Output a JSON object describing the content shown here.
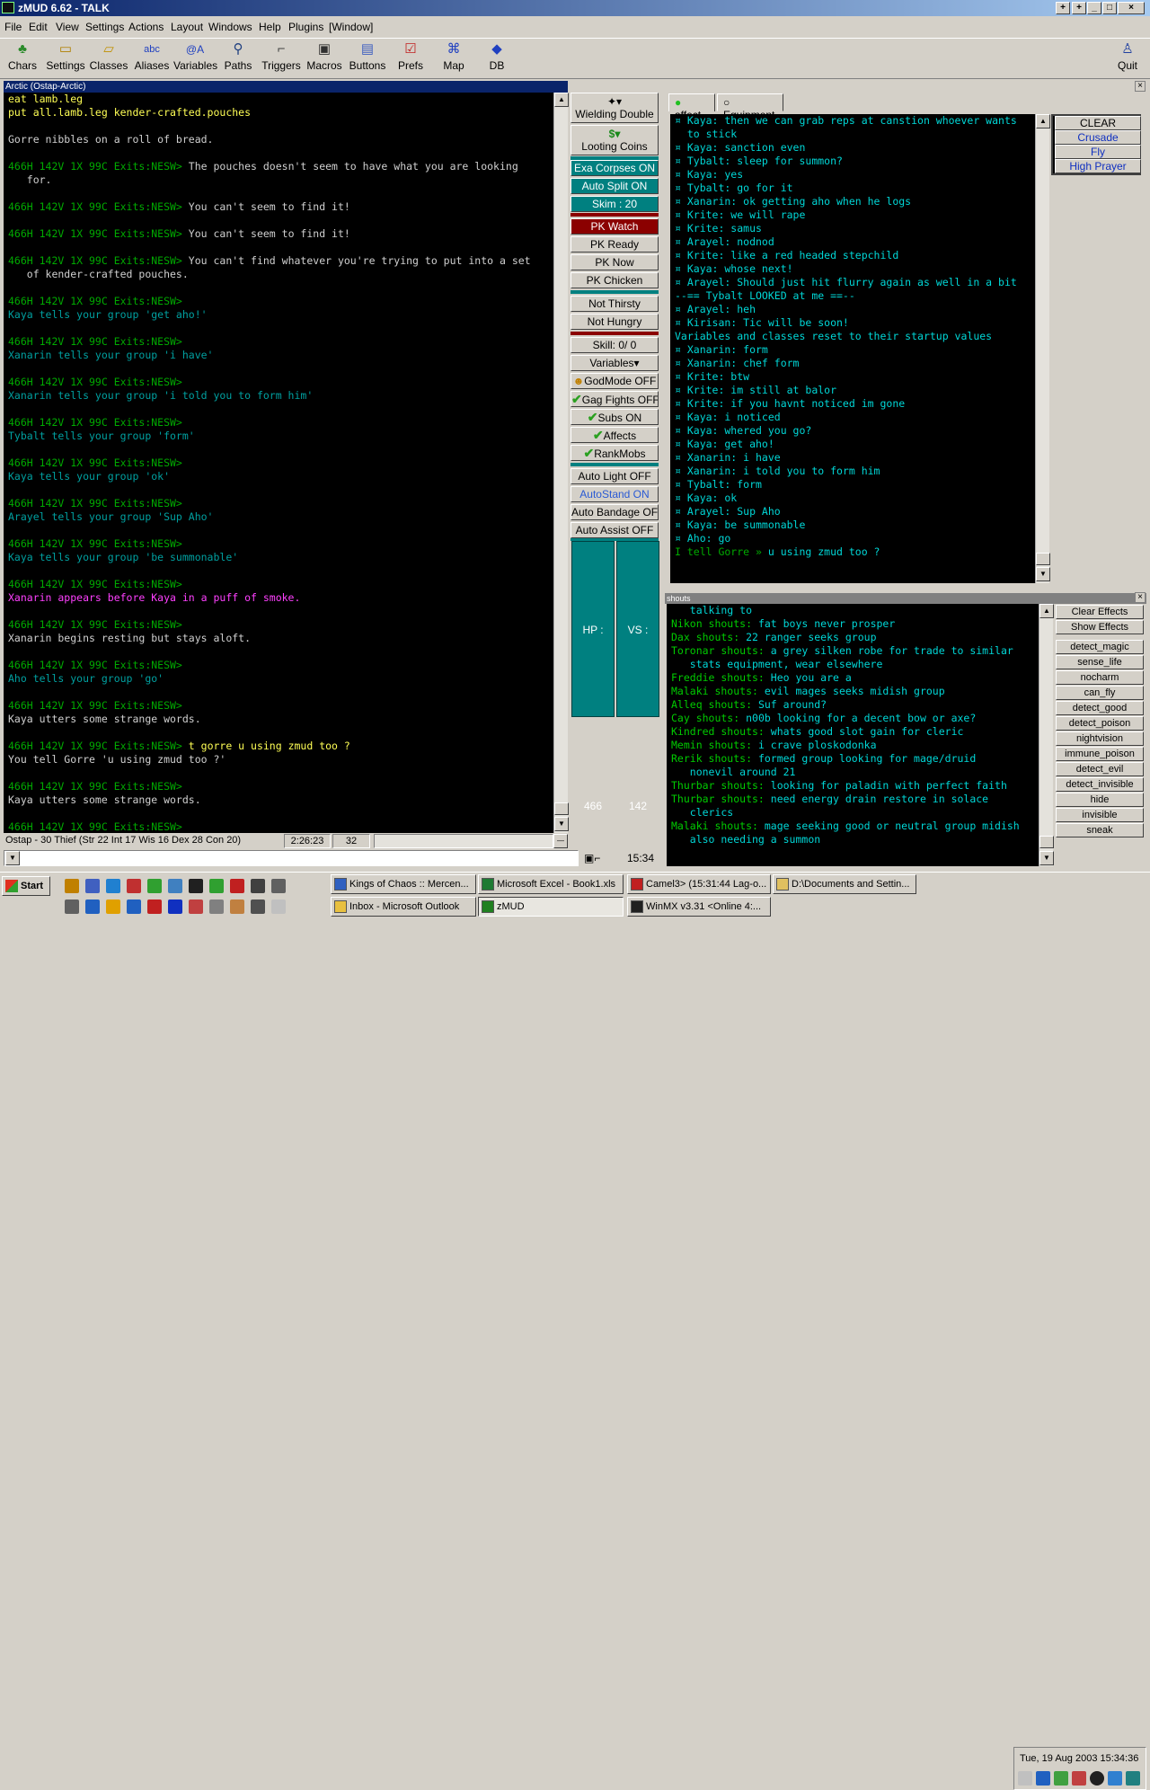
{
  "window": {
    "title": "zMUD 6.62 - TALK"
  },
  "menu": [
    "File",
    "Edit",
    "View",
    "Settings",
    "Actions",
    "Layout",
    "Windows",
    "Help",
    "Plugins",
    "[Window]"
  ],
  "toolbar": [
    {
      "label": "Chars",
      "icon": "chars-icon"
    },
    {
      "label": "Settings",
      "icon": "settings-icon"
    },
    {
      "label": "Classes",
      "icon": "classes-icon"
    },
    {
      "label": "Aliases",
      "icon": "aliases-icon"
    },
    {
      "label": "Variables",
      "icon": "variables-icon"
    },
    {
      "label": "Paths",
      "icon": "paths-icon"
    },
    {
      "label": "Triggers",
      "icon": "triggers-icon"
    },
    {
      "label": "Macros",
      "icon": "macros-icon"
    },
    {
      "label": "Buttons",
      "icon": "buttons-icon"
    },
    {
      "label": "Prefs",
      "icon": "prefs-icon"
    },
    {
      "label": "Map",
      "icon": "map-icon"
    },
    {
      "label": "DB",
      "icon": "db-icon"
    }
  ],
  "quit_label": "Quit",
  "mud": {
    "title": "Arctic (Ostap-Arctic)",
    "lines": [
      {
        "t": "eat lamb.leg",
        "c": "yellow"
      },
      {
        "t": "put all.lamb.leg kender-crafted.pouches",
        "c": "yellow"
      },
      {
        "t": "",
        "c": "white"
      },
      {
        "t": "Gorre nibbles on a roll of bread.",
        "c": "white"
      },
      {
        "t": "",
        "c": "white"
      },
      {
        "p": "466H 142V 1X 99C Exits:NESW> ",
        "t": "The pouches doesn't seem to have what you are looking",
        "c": "white"
      },
      {
        "t": "   for.",
        "c": "white"
      },
      {
        "t": "",
        "c": "white"
      },
      {
        "p": "466H 142V 1X 99C Exits:NESW> ",
        "t": "You can't seem to find it!",
        "c": "white"
      },
      {
        "t": "",
        "c": "white"
      },
      {
        "p": "466H 142V 1X 99C Exits:NESW> ",
        "t": "You can't seem to find it!",
        "c": "white"
      },
      {
        "t": "",
        "c": "white"
      },
      {
        "p": "466H 142V 1X 99C Exits:NESW> ",
        "t": "You can't find whatever you're trying to put into a set",
        "c": "white"
      },
      {
        "t": "   of kender-crafted pouches.",
        "c": "white"
      },
      {
        "t": "",
        "c": "white"
      },
      {
        "p": "466H 142V 1X 99C Exits:NESW>",
        "t": "",
        "c": "white"
      },
      {
        "t": "Kaya tells your group 'get aho!'",
        "c": "teal"
      },
      {
        "t": "",
        "c": "white"
      },
      {
        "p": "466H 142V 1X 99C Exits:NESW>",
        "t": "",
        "c": "white"
      },
      {
        "t": "Xanarin tells your group 'i have'",
        "c": "teal"
      },
      {
        "t": "",
        "c": "white"
      },
      {
        "p": "466H 142V 1X 99C Exits:NESW>",
        "t": "",
        "c": "white"
      },
      {
        "t": "Xanarin tells your group 'i told you to form him'",
        "c": "teal"
      },
      {
        "t": "",
        "c": "white"
      },
      {
        "p": "466H 142V 1X 99C Exits:NESW>",
        "t": "",
        "c": "white"
      },
      {
        "t": "Tybalt tells your group 'form'",
        "c": "teal"
      },
      {
        "t": "",
        "c": "white"
      },
      {
        "p": "466H 142V 1X 99C Exits:NESW>",
        "t": "",
        "c": "white"
      },
      {
        "t": "Kaya tells your group 'ok'",
        "c": "teal"
      },
      {
        "t": "",
        "c": "white"
      },
      {
        "p": "466H 142V 1X 99C Exits:NESW>",
        "t": "",
        "c": "white"
      },
      {
        "t": "Arayel tells your group 'Sup Aho'",
        "c": "teal"
      },
      {
        "t": "",
        "c": "white"
      },
      {
        "p": "466H 142V 1X 99C Exits:NESW>",
        "t": "",
        "c": "white"
      },
      {
        "t": "Kaya tells your group 'be summonable'",
        "c": "teal"
      },
      {
        "t": "",
        "c": "white"
      },
      {
        "p": "466H 142V 1X 99C Exits:NESW>",
        "t": "",
        "c": "white"
      },
      {
        "t": "Xanarin appears before Kaya in a puff of smoke.",
        "c": "magenta"
      },
      {
        "t": "",
        "c": "white"
      },
      {
        "p": "466H 142V 1X 99C Exits:NESW>",
        "t": "",
        "c": "white"
      },
      {
        "t": "Xanarin begins resting but stays aloft.",
        "c": "white"
      },
      {
        "t": "",
        "c": "white"
      },
      {
        "p": "466H 142V 1X 99C Exits:NESW>",
        "t": "",
        "c": "white"
      },
      {
        "t": "Aho tells your group 'go'",
        "c": "teal"
      },
      {
        "t": "",
        "c": "white"
      },
      {
        "p": "466H 142V 1X 99C Exits:NESW>",
        "t": "",
        "c": "white"
      },
      {
        "t": "Kaya utters some strange words.",
        "c": "white"
      },
      {
        "t": "",
        "c": "white"
      },
      {
        "p": "466H 142V 1X 99C Exits:NESW> ",
        "t": "t gorre u using zmud too ?",
        "c": "yellow"
      },
      {
        "t": "You tell Gorre 'u using zmud too ?'",
        "c": "white"
      },
      {
        "t": "",
        "c": "white"
      },
      {
        "p": "466H 142V 1X 99C Exits:NESW>",
        "t": "",
        "c": "white"
      },
      {
        "t": "Kaya utters some strange words.",
        "c": "white"
      },
      {
        "t": "",
        "c": "white"
      },
      {
        "p": "466H 142V 1X 99C Exits:NESW>",
        "t": "",
        "c": "white"
      }
    ]
  },
  "status": {
    "char": "Ostap - 30 Thief (Str 22 Int 17 Wis 16 Dex 28 Con 20)",
    "time": "2:26:23",
    "num": "32",
    "clock": "15:34"
  },
  "buttons": {
    "wielding": "Wielding Double",
    "looting": "Looting Coins",
    "exa": "Exa Corpses ON",
    "autosplit": "Auto Split ON",
    "skim": "Skim : 20",
    "pkwatch": "PK Watch",
    "pkready": "PK Ready",
    "pknow": "PK Now",
    "pkchicken": "PK Chicken",
    "thirsty": "Not Thirsty",
    "hungry": "Not Hungry",
    "skill": "Skill:  0/ 0",
    "variables": "Variables",
    "godmode": "GodMode OFF",
    "gagfights": "Gag Fights OFF",
    "subs": "Subs ON",
    "affects": "Affects",
    "rankmobs": "RankMobs",
    "autolight": "Auto Light OFF",
    "autostand": "AutoStand ON",
    "autobandage": "Auto Bandage OFF",
    "autoassist": "Auto Assist OFF",
    "hp": "HP : 466",
    "vs": "VS : 142"
  },
  "talk": {
    "tabs": [
      "affect",
      "Equipment"
    ],
    "lines": [
      {
        "t": "¤ Kaya: then we can grab reps at canstion whoever wants",
        "c": "cyan"
      },
      {
        "t": "  to stick",
        "c": "cyan"
      },
      {
        "t": "¤ Kaya: sanction even",
        "c": "cyan"
      },
      {
        "t": "¤ Tybalt: sleep for summon?",
        "c": "cyan"
      },
      {
        "t": "¤ Kaya: yes",
        "c": "cyan"
      },
      {
        "t": "¤ Tybalt: go for it",
        "c": "cyan"
      },
      {
        "t": "¤ Xanarin: ok getting aho when he logs",
        "c": "cyan"
      },
      {
        "t": "¤ Krite: we will rape",
        "c": "cyan"
      },
      {
        "t": "¤ Krite: samus",
        "c": "cyan"
      },
      {
        "t": "¤ Arayel: nodnod",
        "c": "cyan"
      },
      {
        "t": "¤ Krite: like a red headed stepchild",
        "c": "cyan"
      },
      {
        "t": "¤ Kaya: whose next!",
        "c": "cyan"
      },
      {
        "t": "¤ Arayel: Should just hit flurry again as well in a bit",
        "c": "cyan"
      },
      {
        "t": "--== Tybalt LOOKED at me ==--",
        "c": "cyan"
      },
      {
        "t": "¤ Arayel: heh",
        "c": "cyan"
      },
      {
        "t": "¤ Kirisan: Tic will be soon!",
        "c": "cyan"
      },
      {
        "t": "Variables and classes reset to their startup values",
        "c": "cyan"
      },
      {
        "t": "¤ Xanarin: form",
        "c": "cyan"
      },
      {
        "t": "¤ Xanarin: chef form",
        "c": "cyan"
      },
      {
        "t": "¤ Krite: btw",
        "c": "cyan"
      },
      {
        "t": "¤ Krite: im still at balor",
        "c": "cyan"
      },
      {
        "t": "¤ Krite: if you havnt noticed im gone",
        "c": "cyan"
      },
      {
        "t": "¤ Kaya: i noticed",
        "c": "cyan"
      },
      {
        "t": "¤ Kaya: whered you go?",
        "c": "cyan"
      },
      {
        "t": "¤ Kaya: get aho!",
        "c": "cyan"
      },
      {
        "t": "¤ Xanarin: i have",
        "c": "cyan"
      },
      {
        "t": "¤ Xanarin: i told you to form him",
        "c": "cyan"
      },
      {
        "t": "¤ Tybalt: form",
        "c": "cyan"
      },
      {
        "t": "¤ Kaya: ok",
        "c": "cyan"
      },
      {
        "t": "¤ Arayel: Sup Aho",
        "c": "cyan"
      },
      {
        "t": "¤ Kaya: be summonable",
        "c": "cyan"
      },
      {
        "t": "¤ Aho: go",
        "c": "cyan"
      },
      {
        "p": "I tell Gorre » ",
        "t": "u using zmud too ?",
        "c": "cyan"
      }
    ],
    "side_buttons": [
      "CLEAR",
      "Crusade",
      "Fly",
      "High Prayer"
    ]
  },
  "shouts": {
    "title": "shouts",
    "lines": [
      {
        "t": "   talking to",
        "c": "cyan"
      },
      {
        "n": "Nikon shouts:",
        "t": " fat boys never prosper"
      },
      {
        "n": "Dax shouts:",
        "t": " 22 ranger seeks group"
      },
      {
        "n": "Toronar shouts:",
        "t": " a grey silken robe for trade to similar"
      },
      {
        "t": "   stats equipment, wear elsewhere",
        "c": "cyan"
      },
      {
        "n": "Freddie shouts:",
        "t": " Heo you are a"
      },
      {
        "n": "Malaki shouts:",
        "t": " evil mages seeks midish group"
      },
      {
        "n": "Alleq shouts:",
        "t": " Suf around?"
      },
      {
        "n": "Cay shouts:",
        "t": " n00b looking for a decent bow or axe?"
      },
      {
        "n": "Kindred shouts:",
        "t": " whats good slot gain for cleric"
      },
      {
        "n": "Memin shouts:",
        "t": " i crave ploskodonka"
      },
      {
        "n": "Rerik shouts:",
        "t": " formed group looking for mage/druid"
      },
      {
        "t": "   nonevil around 21",
        "c": "cyan"
      },
      {
        "n": "Thurbar shouts:",
        "t": " looking for paladin with perfect faith"
      },
      {
        "n": "Thurbar shouts:",
        "t": " need energy drain restore in solace"
      },
      {
        "t": "   clerics",
        "c": "cyan"
      },
      {
        "n": "Malaki shouts:",
        "t": " mage seeking good or neutral group midish"
      },
      {
        "t": "   also needing a summon",
        "c": "cyan"
      }
    ],
    "effect_buttons": [
      "Clear Effects",
      "Show Effects"
    ],
    "effects": [
      "detect_magic",
      "sense_life",
      "nocharm",
      "can_fly",
      "detect_good",
      "detect_poison",
      "nightvision",
      "immune_poison",
      "detect_evil",
      "detect_invisible",
      "hide",
      "invisible",
      "sneak"
    ]
  },
  "taskbar": {
    "start": "Start",
    "tasks": [
      {
        "label": "Kings of Chaos :: Mercen...",
        "color": "#3060c0"
      },
      {
        "label": "Microsoft Excel - Book1.xls",
        "color": "#1e7a32"
      },
      {
        "label": "Camel3> (15:31:44 Lag-o...",
        "color": "#c02020"
      },
      {
        "label": "D:\\Documents and Settin...",
        "color": "#e0c060"
      },
      {
        "label": "Inbox - Microsoft Outlook",
        "color": "#e8c040"
      },
      {
        "label": "zMUD",
        "color": "#208020"
      },
      {
        "label": "WinMX v3.31  <Online 4:...",
        "color": "#202020"
      }
    ],
    "datetime": "Tue, 19 Aug 2003  15:34:36"
  }
}
